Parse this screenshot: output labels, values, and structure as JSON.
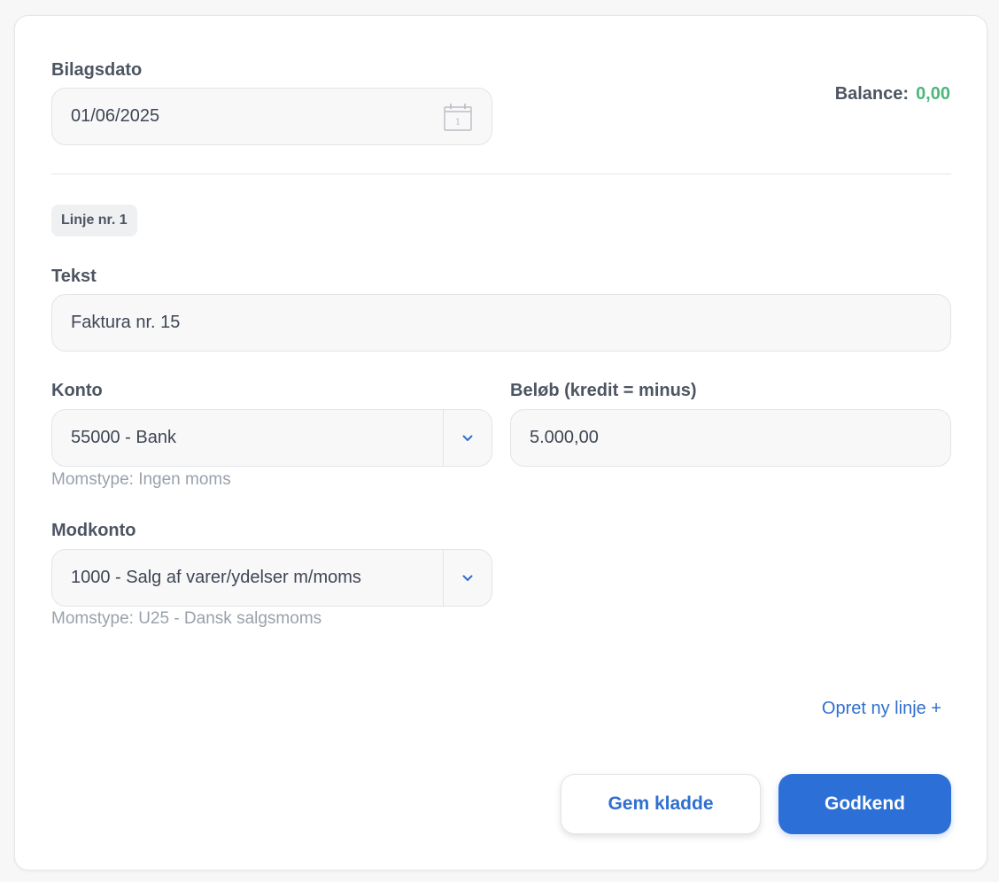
{
  "form": {
    "date_label": "Bilagsdato",
    "date_value": "01/06/2025",
    "calendar_day": "1",
    "balance_label": "Balance:",
    "balance_value": "0,00",
    "line_badge": "Linje nr. 1",
    "text_label": "Tekst",
    "text_value": "Faktura nr. 15",
    "account_label": "Konto",
    "account_value": "55000 - Bank",
    "account_vat": "Momstype: Ingen moms",
    "amount_label": "Beløb (kredit = minus)",
    "amount_value": "5.000,00",
    "counter_label": "Modkonto",
    "counter_value": "1000 - Salg af varer/ydelser m/moms",
    "counter_vat": "Momstype: U25 - Dansk salgsmoms",
    "add_line": "Opret ny linje +",
    "save_draft": "Gem kladde",
    "approve": "Godkend"
  },
  "icons": {
    "date": "calendar-icon",
    "dropdown": "chevron-down-icon"
  },
  "colors": {
    "primary": "#2c6fd6",
    "link": "#2f6fcf",
    "balance_positive": "#4cb77b"
  }
}
